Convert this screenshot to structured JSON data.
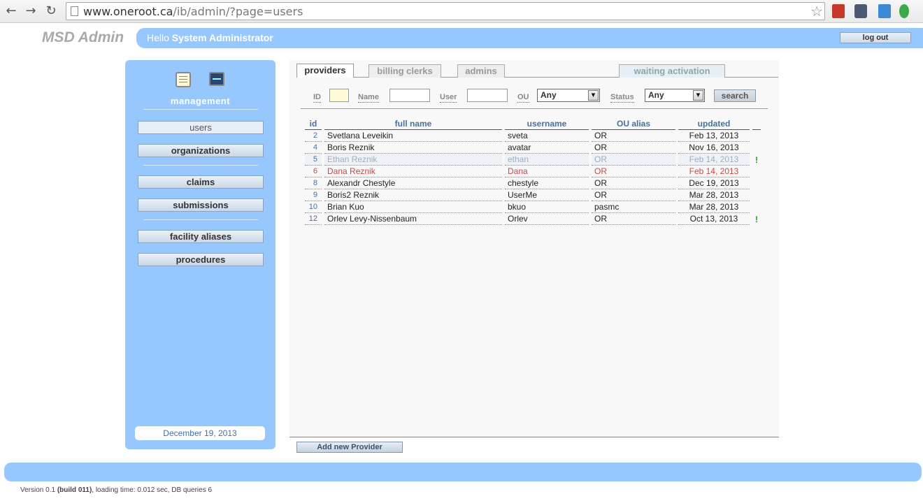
{
  "browser": {
    "url_host": "www.oneroot.ca",
    "url_path": "/ib/admin/?page=users"
  },
  "header": {
    "brand": "MSD Admin",
    "hello_prefix": "Hello",
    "user_name": "System Administrator",
    "logout_label": "log out"
  },
  "sidebar": {
    "section_label": "management",
    "items": [
      {
        "label": "users"
      },
      {
        "label": "organizations"
      },
      {
        "label": "claims"
      },
      {
        "label": "submissions"
      },
      {
        "label": "facility aliases"
      },
      {
        "label": "procedures"
      }
    ],
    "date": "December 19, 2013"
  },
  "tabs": [
    {
      "label": "providers"
    },
    {
      "label": "billing clerks"
    },
    {
      "label": "admins"
    },
    {
      "label": "waiting activation"
    }
  ],
  "filters": {
    "id_label": "ID",
    "name_label": "Name",
    "user_label": "User",
    "ou_label": "OU",
    "ou_value": "Any",
    "status_label": "Status",
    "status_value": "Any",
    "search_label": "search"
  },
  "table": {
    "headers": [
      "id",
      "full name",
      "username",
      "OU alias",
      "updated"
    ],
    "rows": [
      {
        "id": "2",
        "full_name": "Svetlana Leveikin",
        "username": "sveta",
        "ou": "OR",
        "updated": "Feb 13, 2013",
        "flag": ""
      },
      {
        "id": "4",
        "full_name": "Boris Reznik",
        "username": "avatar",
        "ou": "OR",
        "updated": "Nov 16, 2013",
        "flag": ""
      },
      {
        "id": "5",
        "full_name": "Ethan Reznik",
        "username": "ethan",
        "ou": "OR",
        "updated": "Feb 14, 2013",
        "flag": "!"
      },
      {
        "id": "6",
        "full_name": "Dana Reznik",
        "username": "Dana",
        "ou": "OR",
        "updated": "Feb 14, 2013",
        "flag": ""
      },
      {
        "id": "8",
        "full_name": "Alexandr Chestyle",
        "username": "chestyle",
        "ou": "OR",
        "updated": "Dec 19, 2013",
        "flag": ""
      },
      {
        "id": "9",
        "full_name": "Boris2 Reznik",
        "username": "UserMe",
        "ou": "OR",
        "updated": "Mar 28, 2013",
        "flag": ""
      },
      {
        "id": "10",
        "full_name": "Brian Kuo",
        "username": "bkuo",
        "ou": "pasmc",
        "updated": "Mar 28, 2013",
        "flag": ""
      },
      {
        "id": "12",
        "full_name": "Orlev Levy-Nissenbaum",
        "username": "Orlev",
        "ou": "OR",
        "updated": "Oct 13, 2013",
        "flag": "!"
      }
    ]
  },
  "add_provider_label": "Add new Provider",
  "footer": {
    "version_prefix": "Version 0.1",
    "build": "(build 011)",
    "loading": ", loading time: 0.012 sec, DB queries 6"
  }
}
